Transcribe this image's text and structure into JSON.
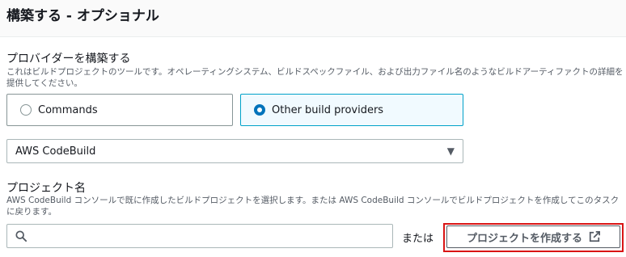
{
  "header": {
    "title": "構築する - オプショナル"
  },
  "provider": {
    "label": "プロバイダーを構築する",
    "description": "これはビルドプロジェクトのツールです。オペレーティングシステム、ビルドスペックファイル、および出力ファイル名のようなビルドアーティファクトの詳細を提供してください。",
    "options": [
      {
        "label": "Commands",
        "selected": false
      },
      {
        "label": "Other build providers",
        "selected": true
      }
    ],
    "select_value": "AWS CodeBuild"
  },
  "project": {
    "label": "プロジェクト名",
    "description": "AWS CodeBuild コンソールで既に作成したビルドプロジェクトを選択します。または AWS CodeBuild コンソールでビルドプロジェクトを作成してこのタスクに戻ります。",
    "search_placeholder": "",
    "or_text": "または",
    "create_button": "プロジェクトを作成する"
  },
  "colors": {
    "accent": "#0073bb",
    "selected_border": "#00a1c9",
    "highlight": "#d91515"
  }
}
